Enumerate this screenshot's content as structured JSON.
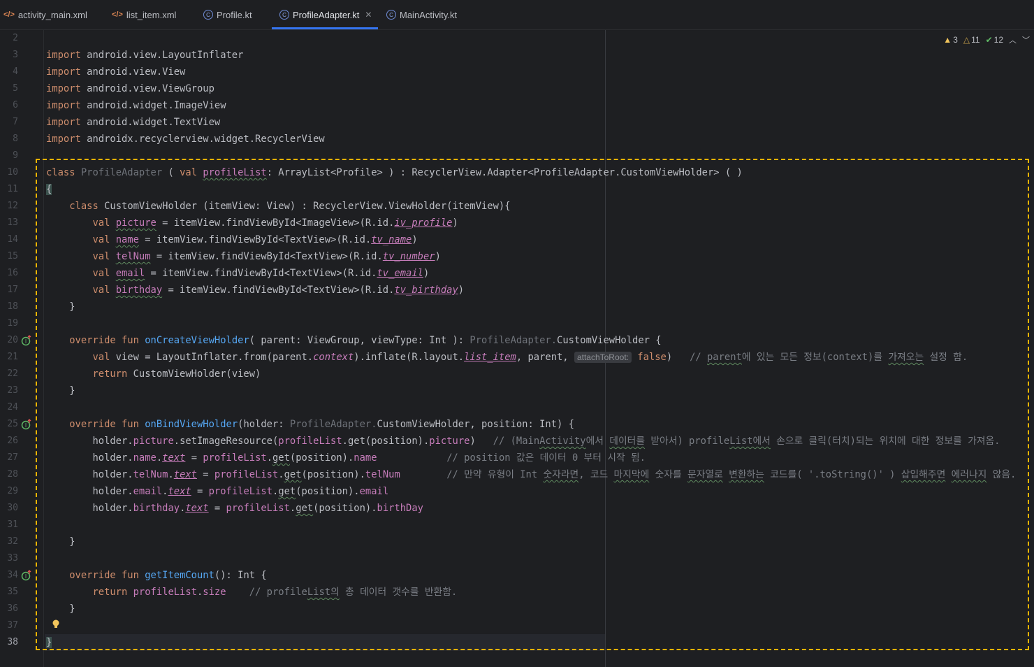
{
  "tabs": [
    {
      "label": "activity_main.xml",
      "icon": "xml-icon"
    },
    {
      "label": "list_item.xml",
      "icon": "xml-icon"
    },
    {
      "label": "Profile.kt",
      "icon": "kotlin-class-icon"
    },
    {
      "label": "ProfileAdapter.kt",
      "icon": "kotlin-class-icon",
      "active": true
    },
    {
      "label": "MainActivity.kt",
      "icon": "kotlin-class-icon"
    }
  ],
  "inspections": {
    "warnings": "3",
    "weak_warnings": "11",
    "typos": "12"
  },
  "line_numbers": [
    "2",
    "3",
    "4",
    "5",
    "6",
    "7",
    "8",
    "9",
    "10",
    "11",
    "12",
    "13",
    "14",
    "15",
    "16",
    "17",
    "18",
    "19",
    "20",
    "21",
    "22",
    "23",
    "24",
    "25",
    "26",
    "27",
    "28",
    "29",
    "30",
    "31",
    "32",
    "33",
    "34",
    "35",
    "36",
    "37",
    "38"
  ],
  "code": {
    "l3": "import android.view.LayoutInflater",
    "l4": "import android.view.View",
    "l5": "import android.view.ViewGroup",
    "l6": "import android.widget.ImageView",
    "l7": "import android.widget.TextView",
    "l8": "import androidx.recyclerview.widget.RecyclerView",
    "l10": "class ProfileAdapter ( val profileList: ArrayList<Profile> ) : RecyclerView.Adapter<ProfileAdapter.CustomViewHolder> ( )",
    "l11": "{",
    "l12": "    class CustomViewHolder (itemView: View) : RecyclerView.ViewHolder(itemView){",
    "l13": "        val picture = itemView.findViewById<ImageView>(R.id.iv_profile)",
    "l14": "        val name = itemView.findViewById<TextView>(R.id.tv_name)",
    "l15": "        val telNum = itemView.findViewById<TextView>(R.id.tv_number)",
    "l16": "        val email = itemView.findViewById<TextView>(R.id.tv_email)",
    "l17": "        val birthday = itemView.findViewById<TextView>(R.id.tv_birthday)",
    "l18": "    }",
    "l20": "    override fun onCreateViewHolder( parent: ViewGroup, viewType: Int ): ProfileAdapter.CustomViewHolder {",
    "l21a": "        val view = LayoutInflater.from(parent.context).inflate(R.layout.list_item, parent, ",
    "l21hint": "attachToRoot:",
    "l21b": " false)   // parent에 있는 모든 정보(context)를 가져오는 설정 함.",
    "l22": "        return CustomViewHolder(view)",
    "l23": "    }",
    "l25": "    override fun onBindViewHolder(holder: ProfileAdapter.CustomViewHolder, position: Int) {",
    "l26": "        holder.picture.setImageResource(profileList.get(position).picture)   // (MainActivity에서 데이터를 받아서) profileList에서 손으로 클릭(터치)되는 위치에 대한 정보를 가져옴.",
    "l27": "        holder.name.text = profileList.get(position).name            // position 값은 데이터 0 부터 시작 됨.",
    "l28": "        holder.telNum.text = profileList.get(position).telNum        // 만약 유형이 Int 숫자라면, 코드 마지막에 숫자를 문자열로 변환하는 코드를( '.toString()' ) 삽입해주면 에러나지 않음.",
    "l29": "        holder.email.text = profileList.get(position).email",
    "l30": "        holder.birthday.text = profileList.get(position).birthDay",
    "l32": "    }",
    "l34": "    override fun getItemCount(): Int {",
    "l35": "        return profileList.size    // profileList의 총 데이터 갯수를 반환함.",
    "l36": "    }",
    "l38": "}"
  }
}
